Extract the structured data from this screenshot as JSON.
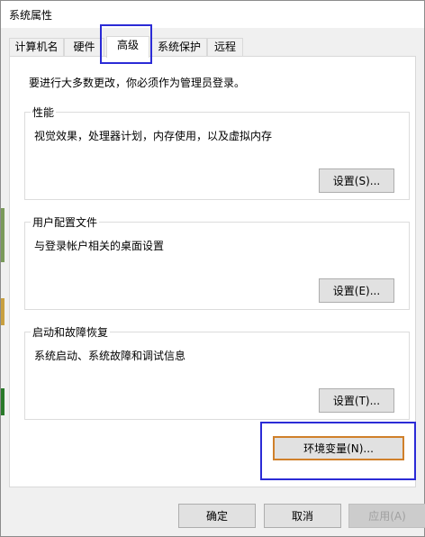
{
  "window": {
    "title": "系统属性"
  },
  "tabs": [
    {
      "label": "计算机名"
    },
    {
      "label": "硬件"
    },
    {
      "label": "高级"
    },
    {
      "label": "系统保护"
    },
    {
      "label": "远程"
    }
  ],
  "panel": {
    "intro": "要进行大多数更改，你必须作为管理员登录。",
    "performance": {
      "title": "性能",
      "description": "视觉效果，处理器计划，内存使用，以及虚拟内存",
      "button": "设置(S)..."
    },
    "profile": {
      "title": "用户配置文件",
      "description": "与登录帐户相关的桌面设置",
      "button": "设置(E)..."
    },
    "startup": {
      "title": "启动和故障恢复",
      "description": "系统启动、系统故障和调试信息",
      "button": "设置(T)..."
    },
    "env_button": "环境变量(N)..."
  },
  "footer": {
    "ok": "确定",
    "cancel": "取消",
    "apply": "应用(A)"
  },
  "colors": {
    "highlight": "#2b2bd6",
    "focus_border": "#d0802a",
    "left_strip": [
      "#5a7a3a",
      "#c8a040",
      "#3a5a8a",
      "#2a7a2a"
    ]
  }
}
